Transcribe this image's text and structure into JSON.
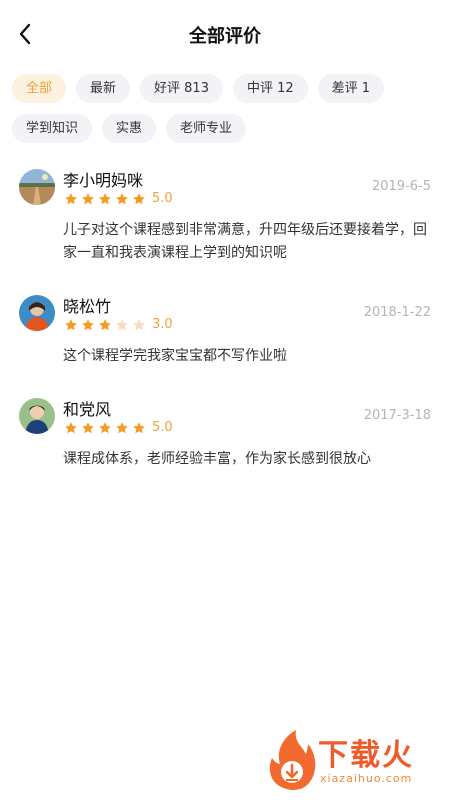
{
  "header": {
    "title": "全部评价",
    "back_icon": "chevron-left-icon"
  },
  "filters": {
    "row1": [
      {
        "label": "全部",
        "active": true
      },
      {
        "label": "最新",
        "active": false
      },
      {
        "label": "好评 813",
        "active": false
      },
      {
        "label": "中评 12",
        "active": false
      },
      {
        "label": "差评 1",
        "active": false
      }
    ],
    "row2": [
      {
        "label": "学到知识",
        "active": false
      },
      {
        "label": "实惠",
        "active": false
      },
      {
        "label": "老师专业",
        "active": false
      }
    ]
  },
  "reviews": [
    {
      "name": "李小明妈咪",
      "rating": 5,
      "rating_text": "5.0",
      "date": "2019-6-5",
      "content": "儿子对这个课程感到非常满意，升四年级后还要接着学，回家一直和我表演课程上学到的知识呢"
    },
    {
      "name": "晓松竹",
      "rating": 3,
      "rating_text": "3.0",
      "date": "2018-1-22",
      "content": "这个课程学完我家宝宝都不写作业啦"
    },
    {
      "name": "和党风",
      "rating": 5,
      "rating_text": "5.0",
      "date": "2017-3-18",
      "content": "课程成体系，老师经验丰富，作为家长感到很放心"
    }
  ],
  "watermark": {
    "text": "下载火",
    "url": "xiazaihuo.com"
  },
  "colors": {
    "accent": "#f0a23a",
    "star_filled": "#f59a23",
    "star_empty": "#f7dcc0",
    "chip_bg": "#f2f3f6",
    "chip_active_bg": "#fdf1e0"
  }
}
